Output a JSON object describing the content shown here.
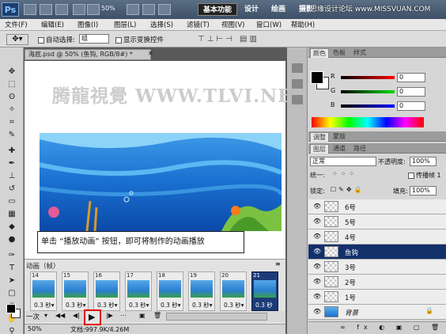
{
  "titlebar": {
    "logo": "Ps",
    "zoom": "50%",
    "workspaces": [
      "基本功能",
      "设计",
      "绘画",
      "摄影"
    ],
    "watermark": "思缘设计论坛 www.MISSVUAN.COM"
  },
  "menu": [
    "文件(F)",
    "编辑(E)",
    "图像(I)",
    "图层(L)",
    "选择(S)",
    "滤镜(T)",
    "视图(V)",
    "窗口(W)",
    "帮助(H)"
  ],
  "options": {
    "auto_select": "自动选择:",
    "auto_select_value": "组",
    "show_transform": "显示变换控件"
  },
  "document": {
    "tab_title": "海底.psd @ 50% (鱼钩, RGB/8#) *",
    "watermark": "腾龍視覺 WWW.TLVI.NE"
  },
  "caption": "单击 “播放动画” 按钮，即可将制作的动画播放",
  "animation": {
    "title": "动画（帧）",
    "frames": [
      {
        "num": "14",
        "dur": "0.3 秒▾"
      },
      {
        "num": "15",
        "dur": "0.3 秒▾"
      },
      {
        "num": "16",
        "dur": "0.3 秒▾"
      },
      {
        "num": "17",
        "dur": "0.3 秒▾"
      },
      {
        "num": "18",
        "dur": "0.3 秒▾"
      },
      {
        "num": "19",
        "dur": "0.3 秒▾"
      },
      {
        "num": "20",
        "dur": "0.3 秒▾"
      },
      {
        "num": "21",
        "dur": "0.3 秒"
      }
    ],
    "loop": "一次"
  },
  "status": {
    "zoom": "50%",
    "doc": "文档:997.9K/4.26M"
  },
  "color_panel": {
    "tabs": [
      "颜色",
      "色板",
      "样式"
    ],
    "r_label": "R",
    "g_label": "G",
    "b_label": "B",
    "r": "0",
    "g": "0",
    "b": "0"
  },
  "adjust_tabs": [
    "调整",
    "蒙版"
  ],
  "layers_panel": {
    "tabs": [
      "图层",
      "通道",
      "路径"
    ],
    "blend": "正常",
    "opacity_label": "不透明度:",
    "opacity": "100%",
    "unify": "统一:",
    "propagate": "传播帧 1",
    "lock": "锁定:",
    "fill_label": "填充:",
    "fill": "100%",
    "layers": [
      {
        "name": "6号"
      },
      {
        "name": "5号"
      },
      {
        "name": "4号"
      },
      {
        "name": "鱼钩"
      },
      {
        "name": "3号"
      },
      {
        "name": "2号"
      },
      {
        "name": "1号"
      },
      {
        "name": "背景"
      }
    ]
  }
}
